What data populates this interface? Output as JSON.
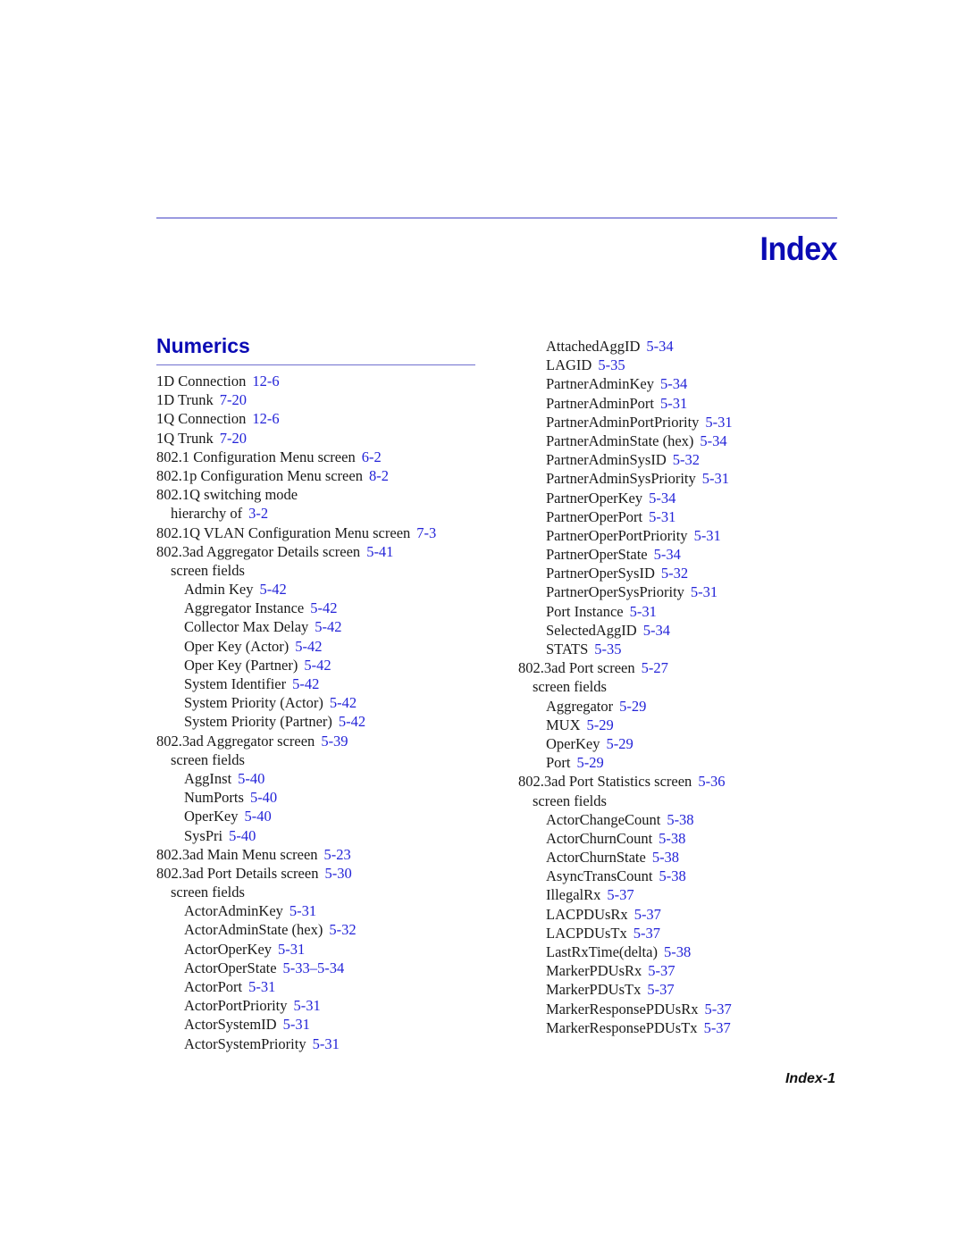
{
  "page": {
    "title": "Index",
    "section": "Numerics",
    "footer": "Index-1",
    "colors": {
      "heading": "#0a0ab4",
      "link": "#2323d8",
      "rule": "#9a9ae0",
      "text": "#1a1a1a"
    }
  },
  "left_column": [
    {
      "level": 0,
      "term": "1D Connection",
      "ref": "12-6"
    },
    {
      "level": 0,
      "term": "1D Trunk",
      "ref": "7-20"
    },
    {
      "level": 0,
      "term": "1Q Connection",
      "ref": "12-6"
    },
    {
      "level": 0,
      "term": "1Q Trunk",
      "ref": "7-20"
    },
    {
      "level": 0,
      "term": "802.1 Configuration Menu screen",
      "ref": "6-2"
    },
    {
      "level": 0,
      "term": "802.1p Configuration Menu screen",
      "ref": "8-2"
    },
    {
      "level": 0,
      "term": "802.1Q switching mode",
      "ref": ""
    },
    {
      "level": 1,
      "term": "hierarchy of",
      "ref": "3-2"
    },
    {
      "level": 0,
      "term": "802.1Q VLAN Configuration Menu screen",
      "ref": "7-3"
    },
    {
      "level": 0,
      "term": "802.3ad Aggregator Details screen",
      "ref": "5-41"
    },
    {
      "level": 1,
      "term": "screen fields",
      "ref": ""
    },
    {
      "level": 2,
      "term": "Admin Key",
      "ref": "5-42"
    },
    {
      "level": 2,
      "term": "Aggregator Instance",
      "ref": "5-42"
    },
    {
      "level": 2,
      "term": "Collector Max Delay",
      "ref": "5-42"
    },
    {
      "level": 2,
      "term": "Oper Key (Actor)",
      "ref": "5-42"
    },
    {
      "level": 2,
      "term": "Oper Key (Partner)",
      "ref": "5-42"
    },
    {
      "level": 2,
      "term": "System Identifier",
      "ref": "5-42"
    },
    {
      "level": 2,
      "term": "System Priority (Actor)",
      "ref": "5-42"
    },
    {
      "level": 2,
      "term": "System Priority (Partner)",
      "ref": "5-42"
    },
    {
      "level": 0,
      "term": "802.3ad Aggregator screen",
      "ref": "5-39"
    },
    {
      "level": 1,
      "term": "screen fields",
      "ref": ""
    },
    {
      "level": 2,
      "term": "AggInst",
      "ref": "5-40"
    },
    {
      "level": 2,
      "term": "NumPorts",
      "ref": "5-40"
    },
    {
      "level": 2,
      "term": "OperKey",
      "ref": "5-40"
    },
    {
      "level": 2,
      "term": "SysPri",
      "ref": "5-40"
    },
    {
      "level": 0,
      "term": "802.3ad Main Menu screen",
      "ref": "5-23"
    },
    {
      "level": 0,
      "term": "802.3ad Port Details screen",
      "ref": "5-30"
    },
    {
      "level": 1,
      "term": "screen fields",
      "ref": ""
    },
    {
      "level": 2,
      "term": "ActorAdminKey",
      "ref": "5-31"
    },
    {
      "level": 2,
      "term": "ActorAdminState (hex)",
      "ref": "5-32"
    },
    {
      "level": 2,
      "term": "ActorOperKey",
      "ref": "5-31"
    },
    {
      "level": 2,
      "term": "ActorOperState",
      "ref": "5-33–5-34"
    },
    {
      "level": 2,
      "term": "ActorPort",
      "ref": "5-31"
    },
    {
      "level": 2,
      "term": "ActorPortPriority",
      "ref": "5-31"
    },
    {
      "level": 2,
      "term": "ActorSystemID",
      "ref": "5-31"
    },
    {
      "level": 2,
      "term": "ActorSystemPriority",
      "ref": "5-31"
    }
  ],
  "right_column": [
    {
      "level": 2,
      "term": "AttachedAggID",
      "ref": "5-34"
    },
    {
      "level": 2,
      "term": "LAGID",
      "ref": "5-35"
    },
    {
      "level": 2,
      "term": "PartnerAdminKey",
      "ref": "5-34"
    },
    {
      "level": 2,
      "term": "PartnerAdminPort",
      "ref": "5-31"
    },
    {
      "level": 2,
      "term": "PartnerAdminPortPriority",
      "ref": "5-31"
    },
    {
      "level": 2,
      "term": "PartnerAdminState (hex)",
      "ref": "5-34"
    },
    {
      "level": 2,
      "term": "PartnerAdminSysID",
      "ref": "5-32"
    },
    {
      "level": 2,
      "term": "PartnerAdminSysPriority",
      "ref": "5-31"
    },
    {
      "level": 2,
      "term": "PartnerOperKey",
      "ref": "5-34"
    },
    {
      "level": 2,
      "term": "PartnerOperPort",
      "ref": "5-31"
    },
    {
      "level": 2,
      "term": "PartnerOperPortPriority",
      "ref": "5-31"
    },
    {
      "level": 2,
      "term": "PartnerOperState",
      "ref": "5-34"
    },
    {
      "level": 2,
      "term": "PartnerOperSysID",
      "ref": "5-32"
    },
    {
      "level": 2,
      "term": "PartnerOperSysPriority",
      "ref": "5-31"
    },
    {
      "level": 2,
      "term": "Port Instance",
      "ref": "5-31"
    },
    {
      "level": 2,
      "term": "SelectedAggID",
      "ref": "5-34"
    },
    {
      "level": 2,
      "term": "STATS",
      "ref": "5-35"
    },
    {
      "level": 0,
      "term": "802.3ad Port screen",
      "ref": "5-27"
    },
    {
      "level": 1,
      "term": "screen fields",
      "ref": ""
    },
    {
      "level": 2,
      "term": "Aggregator",
      "ref": "5-29"
    },
    {
      "level": 2,
      "term": "MUX",
      "ref": "5-29"
    },
    {
      "level": 2,
      "term": "OperKey",
      "ref": "5-29"
    },
    {
      "level": 2,
      "term": "Port",
      "ref": "5-29"
    },
    {
      "level": 0,
      "term": "802.3ad Port Statistics screen",
      "ref": "5-36"
    },
    {
      "level": 1,
      "term": "screen fields",
      "ref": ""
    },
    {
      "level": 2,
      "term": "ActorChangeCount",
      "ref": "5-38"
    },
    {
      "level": 2,
      "term": "ActorChurnCount",
      "ref": "5-38"
    },
    {
      "level": 2,
      "term": "ActorChurnState",
      "ref": "5-38"
    },
    {
      "level": 2,
      "term": "AsyncTransCount",
      "ref": "5-38"
    },
    {
      "level": 2,
      "term": "IllegalRx",
      "ref": "5-37"
    },
    {
      "level": 2,
      "term": "LACPDUsRx",
      "ref": "5-37"
    },
    {
      "level": 2,
      "term": "LACPDUsTx",
      "ref": "5-37"
    },
    {
      "level": 2,
      "term": "LastRxTime(delta)",
      "ref": "5-38"
    },
    {
      "level": 2,
      "term": "MarkerPDUsRx",
      "ref": "5-37"
    },
    {
      "level": 2,
      "term": "MarkerPDUsTx",
      "ref": "5-37"
    },
    {
      "level": 2,
      "term": "MarkerResponsePDUsRx",
      "ref": "5-37"
    },
    {
      "level": 2,
      "term": "MarkerResponsePDUsTx",
      "ref": "5-37"
    }
  ]
}
